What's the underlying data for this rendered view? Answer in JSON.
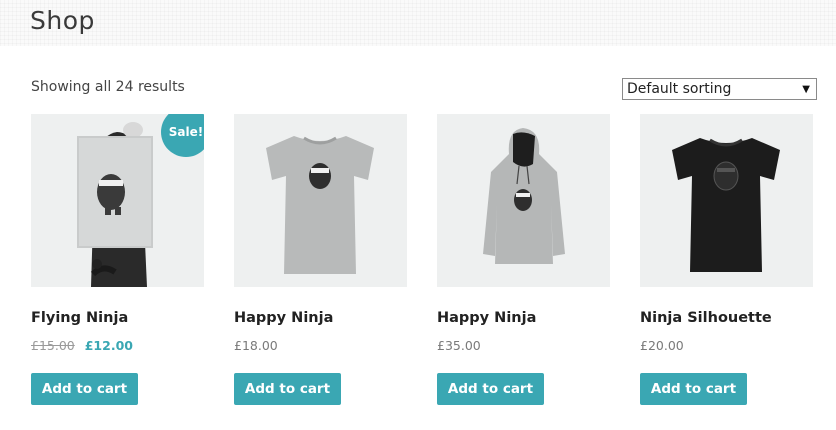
{
  "page": {
    "title": "Shop"
  },
  "toolbar": {
    "result_count": "Showing all 24 results",
    "sorting": {
      "selected": "Default sorting"
    }
  },
  "colors": {
    "accent": "#3aa7b3"
  },
  "products": [
    {
      "name": "Flying Ninja",
      "price_old": "£15.00",
      "price": "£12.00",
      "badge": "Sale!",
      "button": "Add to cart",
      "image": "poster-ninja"
    },
    {
      "name": "Happy Ninja",
      "price": "£18.00",
      "button": "Add to cart",
      "image": "grey-tshirt"
    },
    {
      "name": "Happy Ninja",
      "price": "£35.00",
      "button": "Add to cart",
      "image": "grey-hoodie"
    },
    {
      "name": "Ninja Silhouette",
      "price": "£20.00",
      "button": "Add to cart",
      "image": "black-tshirt"
    }
  ]
}
